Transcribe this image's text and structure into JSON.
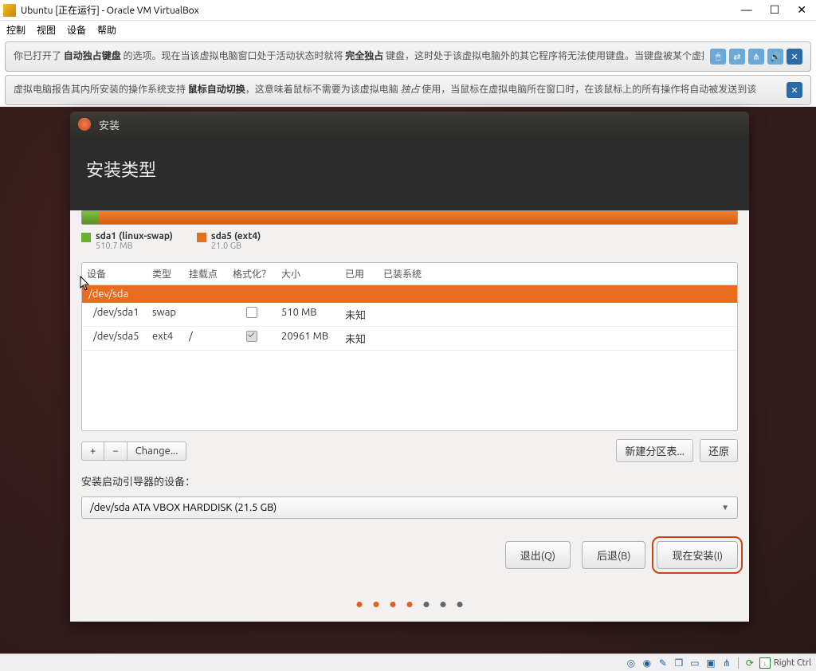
{
  "vbox": {
    "title": "Ubuntu [正在运行] - Oracle VM VirtualBox",
    "menu": [
      "控制",
      "视图",
      "设备",
      "帮助"
    ]
  },
  "notifications": [
    {
      "pre": "你已打开了 ",
      "b1": "自动独占键盘",
      "mid": " 的选项。现在当该虚拟电脑窗口处于活动状态时就将 ",
      "b2": "完全独占",
      "post": " 键盘，这时处于该虚拟电脑外的其它程序将无法使用键盘。当键盘被某个虚拟电脑独占"
    },
    {
      "pre": "虚拟电脑报告其内所安装的操作系统支持 ",
      "b1": "鼠标自动切换",
      "mid": "，这意味着鼠标不需要为该虚拟电脑 ",
      "b2": "独占",
      "post": " 使用，当鼠标在虚拟电脑所在窗口时，在该鼠标上的所有操作将自动被发送到该"
    }
  ],
  "installer": {
    "window_title": "安装",
    "heading": "安装类型",
    "legend": [
      {
        "label": "sda1 (linux-swap)",
        "size": "510.7 MB"
      },
      {
        "label": "sda5 (ext4)",
        "size": "21.0 GB"
      }
    ],
    "table": {
      "headers": {
        "dev": "设备",
        "type": "类型",
        "mount": "挂载点",
        "fmt": "格式化？",
        "size": "大小",
        "used": "已用",
        "sys": "已装系统"
      },
      "group": "/dev/sda",
      "rows": [
        {
          "dev": "/dev/sda1",
          "type": "swap",
          "mount": "",
          "fmt": false,
          "size": "510 MB",
          "used": "未知",
          "sys": ""
        },
        {
          "dev": "/dev/sda5",
          "type": "ext4",
          "mount": "/",
          "fmt": true,
          "size": "20961 MB",
          "used": "未知",
          "sys": ""
        }
      ]
    },
    "toolbar": {
      "add": "+",
      "remove": "−",
      "change": "Change...",
      "new_table": "新建分区表...",
      "revert": "还原"
    },
    "boot_label": "安装启动引导器的设备：",
    "boot_value": "/dev/sda   ATA VBOX HARDDISK (21.5 GB)",
    "nav": {
      "quit": "退出(Q)",
      "back": "后退(B)",
      "install": "现在安装(I)"
    }
  },
  "statusbar": {
    "host": "Right Ctrl"
  }
}
